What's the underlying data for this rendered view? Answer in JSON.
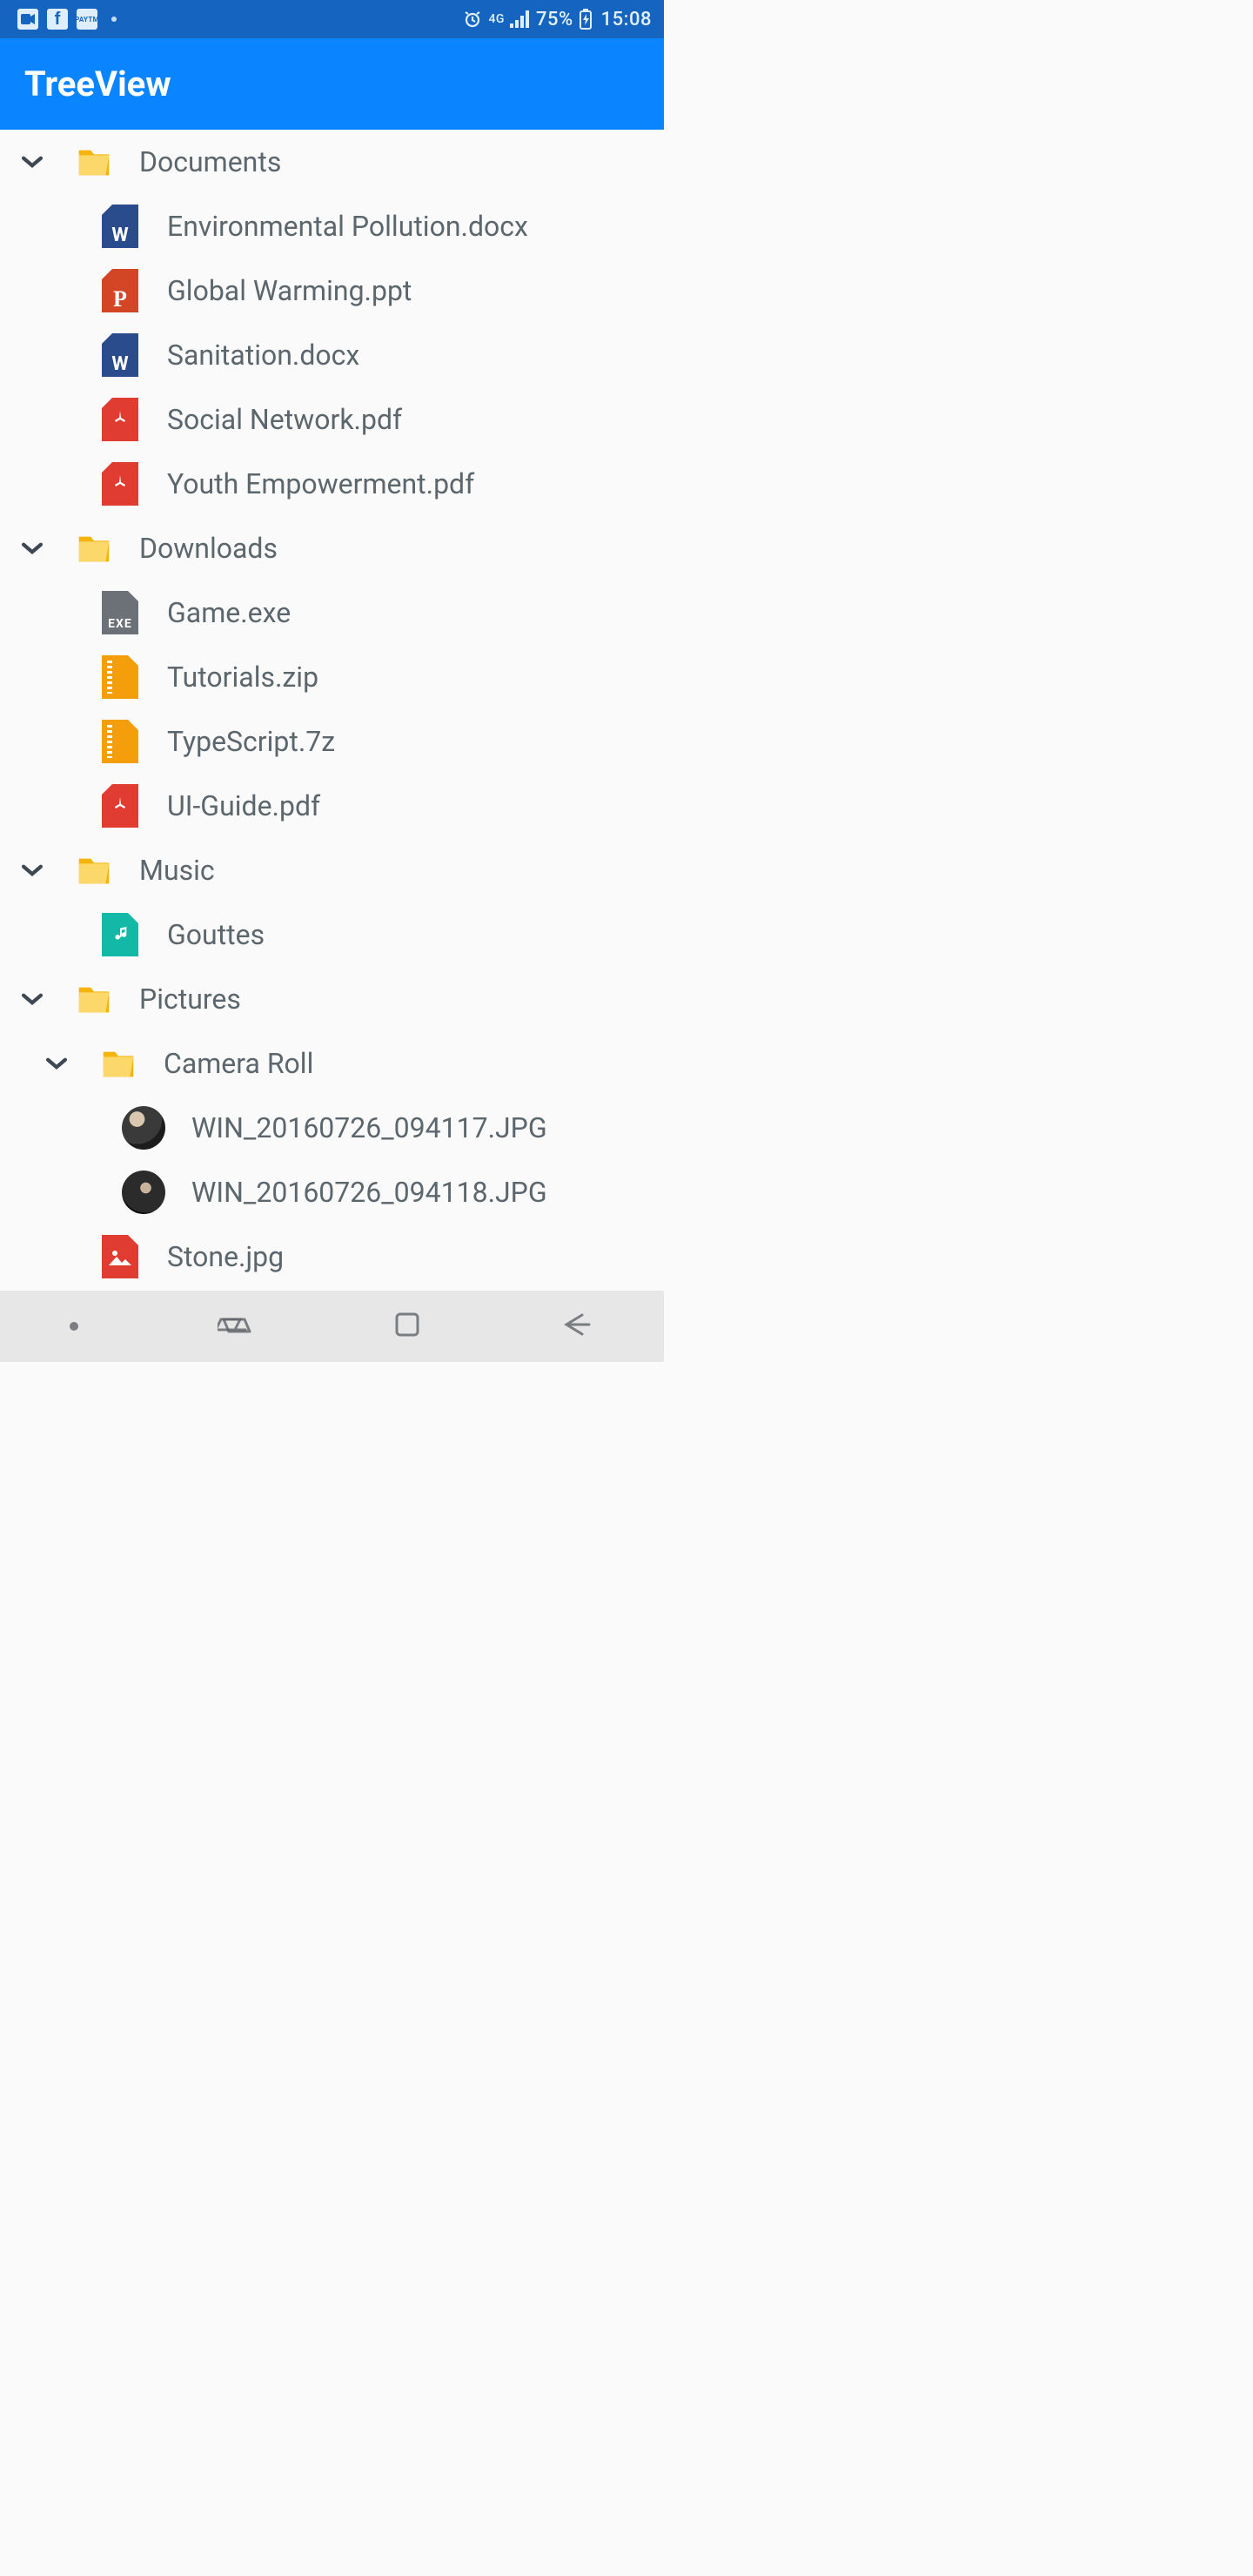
{
  "status_bar": {
    "battery": "75%",
    "time": "15:08",
    "network": "4G"
  },
  "app": {
    "title": "TreeView"
  },
  "tree": {
    "nodes": [
      {
        "label": "Documents",
        "type": "folder",
        "expanded": true,
        "children": [
          {
            "label": "Environmental Pollution.docx",
            "type": "docx"
          },
          {
            "label": "Global Warming.ppt",
            "type": "ppt"
          },
          {
            "label": "Sanitation.docx",
            "type": "docx"
          },
          {
            "label": "Social Network.pdf",
            "type": "pdf"
          },
          {
            "label": "Youth Empowerment.pdf",
            "type": "pdf"
          }
        ]
      },
      {
        "label": "Downloads",
        "type": "folder",
        "expanded": true,
        "children": [
          {
            "label": "Game.exe",
            "type": "exe"
          },
          {
            "label": "Tutorials.zip",
            "type": "zip"
          },
          {
            "label": "TypeScript.7z",
            "type": "zip"
          },
          {
            "label": "UI-Guide.pdf",
            "type": "pdf"
          }
        ]
      },
      {
        "label": "Music",
        "type": "folder",
        "expanded": true,
        "children": [
          {
            "label": "Gouttes",
            "type": "audio"
          }
        ]
      },
      {
        "label": "Pictures",
        "type": "folder",
        "expanded": true,
        "children": [
          {
            "label": "Camera Roll",
            "type": "folder",
            "expanded": true,
            "children": [
              {
                "label": "WIN_20160726_094117.JPG",
                "type": "photo"
              },
              {
                "label": "WIN_20160726_094118.JPG",
                "type": "photo"
              }
            ]
          },
          {
            "label": "Stone.jpg",
            "type": "image"
          }
        ]
      }
    ]
  }
}
